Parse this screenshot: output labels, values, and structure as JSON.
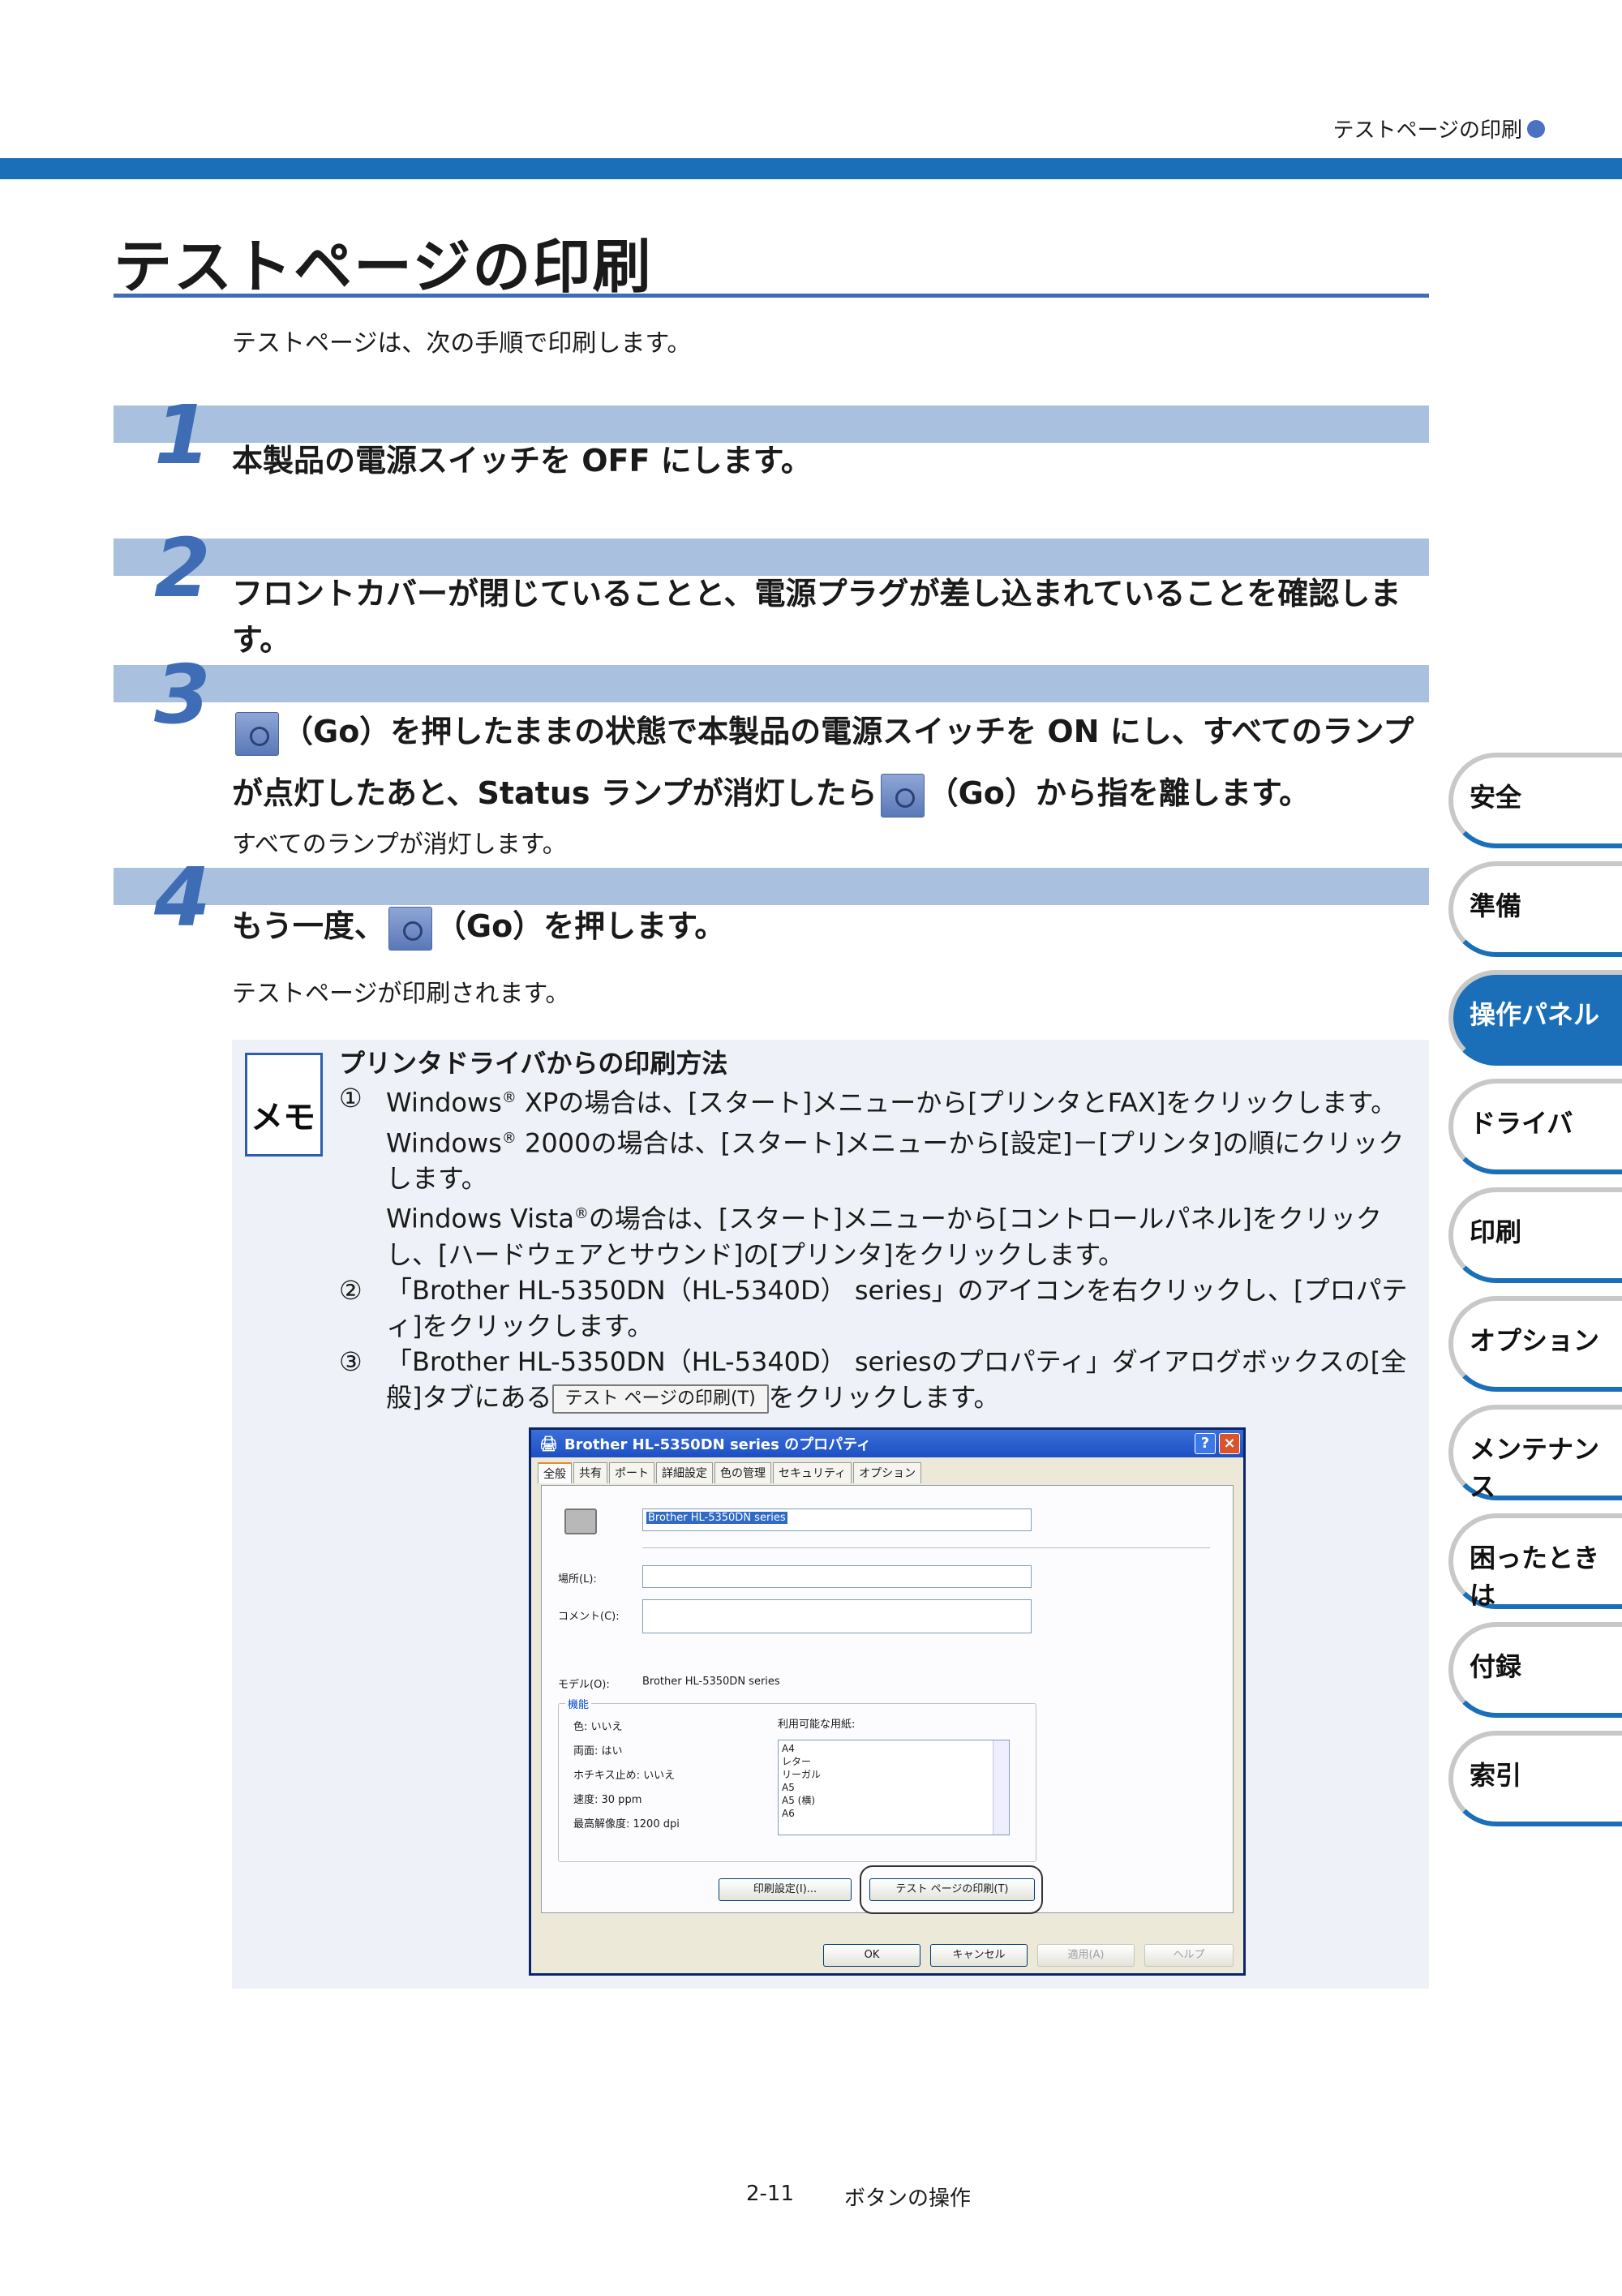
{
  "header": {
    "running_title": "テストページの印刷"
  },
  "page": {
    "title": "テストページの印刷",
    "intro": "テストページは、次の手順で印刷します。"
  },
  "steps": [
    {
      "num": "1",
      "text": "本製品の電源スイッチを OFF にします。"
    },
    {
      "num": "2",
      "text": "フロントカバーが閉じていることと、電源プラグが差し込まれていることを確認します。"
    },
    {
      "num": "3",
      "text_a": "（Go）を押したままの状態で本製品の電源スイッチを ON にし、すべてのランプが点灯したあと、Status ランプが消灯したら",
      "text_b": "（Go）から指を離します。",
      "sub": "すべてのランプが消灯します。"
    },
    {
      "num": "4",
      "text_a": "もう一度、",
      "text_b": "（Go）を押します。",
      "sub": "テストページが印刷されます。"
    }
  ],
  "memo": {
    "icon_text": "メモ",
    "title": "プリンタドライバからの印刷方法",
    "items": [
      {
        "mark": "①",
        "line1_a": "Windows",
        "reg": "®",
        "line1_b": " XPの場合は、[スタート]メニューから[プリンタとFAX]をクリックします。",
        "line2_a": "Windows",
        "line2_b": " 2000の場合は、[スタート]メニューから[設定]－[プリンタ]の順にクリックします。",
        "line3_a": "Windows Vista",
        "line3_b": "の場合は、[スタート]メニューから[コントロールパネル]をクリックし、[ハードウェアとサウンド]の[プリンタ]をクリックします。"
      },
      {
        "mark": "②",
        "text": "「Brother HL-5350DN（HL-5340D） series」のアイコンを右クリックし、[プロパティ]をクリックします。"
      },
      {
        "mark": "③",
        "text_a": "「Brother HL-5350DN（HL-5340D） seriesのプロパティ」ダイアログボックスの[全般]タブにある",
        "button": "テスト ページの印刷(T)",
        "text_b": "をクリックします。"
      }
    ]
  },
  "dialog": {
    "title": "Brother HL-5350DN series のプロパティ",
    "help_btn": "?",
    "close_btn": "×",
    "tabs": [
      "全般",
      "共有",
      "ポート",
      "詳細設定",
      "色の管理",
      "セキュリティ",
      "オプション"
    ],
    "printer_name": "Brother HL-5350DN series",
    "location_label": "場所(L):",
    "comment_label": "コメント(C):",
    "model_label": "モデル(O):",
    "model_value": "Brother HL-5350DN series",
    "features_legend": "機能",
    "features": [
      "色: いいえ",
      "両面: はい",
      "ホチキス止め: いいえ",
      "速度: 30 ppm",
      "最高解像度: 1200 dpi"
    ],
    "paper_label": "利用可能な用紙:",
    "papers": [
      "A4",
      "レター",
      "リーガル",
      "A5",
      "A5 (横)",
      "A6"
    ],
    "pref_btn": "印刷設定(I)...",
    "test_btn": "テスト ページの印刷(T)",
    "ok_btn": "OK",
    "cancel_btn": "キャンセル",
    "apply_btn": "適用(A)",
    "help_bottom_btn": "ヘルプ"
  },
  "side_tabs": [
    "安全",
    "準備",
    "操作パネル",
    "ドライバ",
    "印刷",
    "オプション",
    "メンテナンス",
    "困ったときは",
    "付録",
    "索引"
  ],
  "side_active": "操作パネル",
  "footer": {
    "page_no": "2-11",
    "section": "ボタンの操作"
  }
}
